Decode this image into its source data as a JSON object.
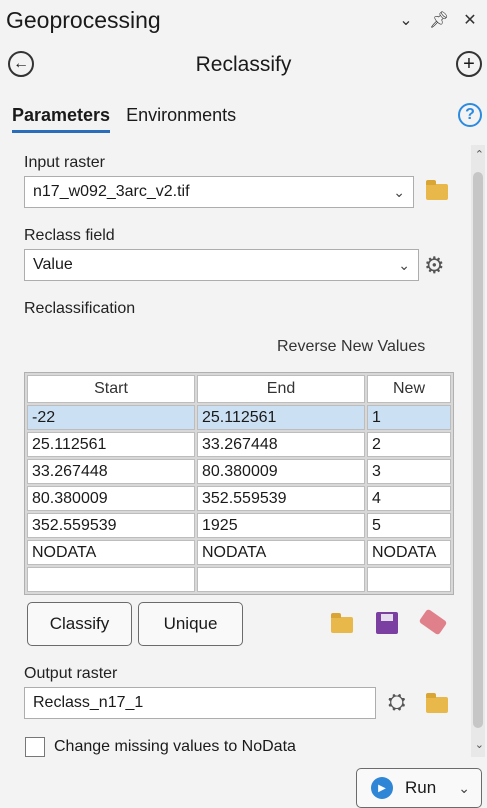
{
  "header": {
    "title": "Geoprocessing",
    "icons": [
      "chevron-down-icon",
      "pin-icon",
      "close-icon"
    ]
  },
  "tool": {
    "title": "Reclassify"
  },
  "tabs": [
    {
      "label": "Parameters",
      "active": true
    },
    {
      "label": "Environments",
      "active": false
    }
  ],
  "input_raster": {
    "label": "Input raster",
    "value": "n17_w092_3arc_v2.tif"
  },
  "reclass_field": {
    "label": "Reclass field",
    "value": "Value"
  },
  "reclassification": {
    "label": "Reclassification",
    "reverse_label": "Reverse New Values",
    "columns": [
      "Start",
      "End",
      "New"
    ],
    "rows": [
      [
        "-22",
        "25.112561",
        "1"
      ],
      [
        "25.112561",
        "33.267448",
        "2"
      ],
      [
        "33.267448",
        "80.380009",
        "3"
      ],
      [
        "80.380009",
        "352.559539",
        "4"
      ],
      [
        "352.559539",
        "1925",
        "5"
      ],
      [
        "NODATA",
        "NODATA",
        "NODATA"
      ],
      [
        "",
        "",
        ""
      ]
    ]
  },
  "buttons": {
    "classify": "Classify",
    "unique": "Unique",
    "run": "Run"
  },
  "output_raster": {
    "label": "Output raster",
    "value": "Reclass_n17_1"
  },
  "missing_values": {
    "label": "Change missing values to NoData",
    "checked": false
  }
}
